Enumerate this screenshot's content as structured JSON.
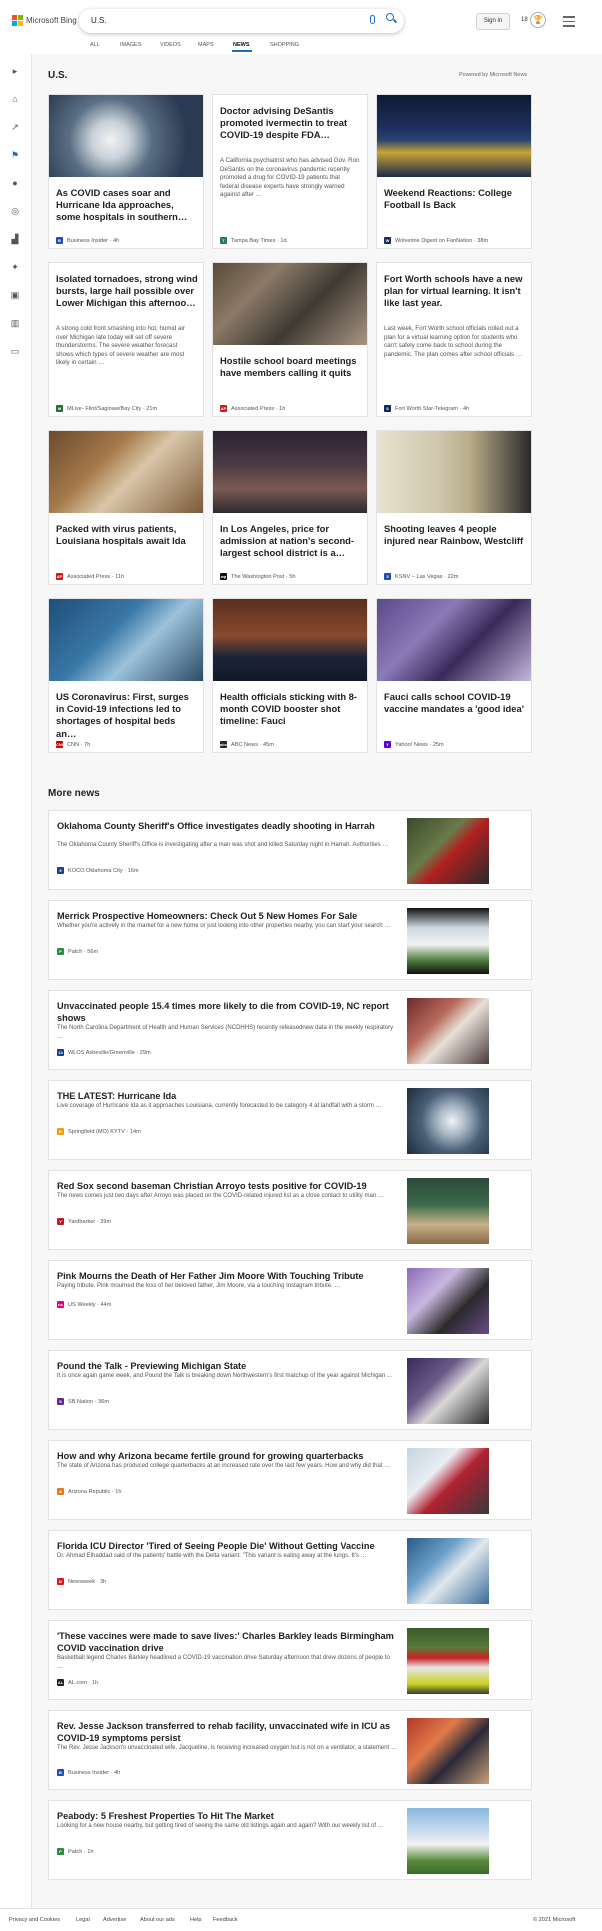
{
  "header": {
    "brand": "Microsoft Bing",
    "query": "U.S.",
    "signin": "Sign in",
    "points": "18"
  },
  "tabs": [
    "ALL",
    "IMAGES",
    "VIDEOS",
    "MAPS",
    "NEWS",
    "SHOPPING"
  ],
  "section": {
    "title": "U.S.",
    "powered": "Powered by Microsoft News"
  },
  "cards": [
    {
      "title": "As COVID cases soar and Hurricane Ida approaches, some hospitals in southern…",
      "desc": "",
      "source": "Business Insider · 4h",
      "logo": "#1f4fb5",
      "logo_text": "B"
    },
    {
      "title": "Doctor advising DeSantis promoted ivermectin to treat COVID-19 despite FDA…",
      "desc": "A California psychiatrist who has advised Gov. Ron DeSantis on the coronavirus pandemic recently promoted a drug for COVID-19 patients that federal disease experts have strongly warned against after …",
      "source": "Tampa Bay Times · 1d",
      "logo": "#2d7a4c",
      "logo_text": "T"
    },
    {
      "title": "Weekend Reactions: College Football Is Back",
      "desc": "",
      "source": "Wolverine Digest on FanNation · 38m",
      "logo": "#1a2a5a",
      "logo_text": "W"
    },
    {
      "title": "Isolated tornadoes, strong wind bursts, large hail possible over Lower Michigan this afternoo…",
      "desc": "A strong cold front smashing into hot, humid air over Michigan late today will set off severe thunderstorms. The severe weather forecast shows which types of severe weather are most likely in certain …",
      "source": "MLive- Flint/Saginaw/Bay City · 21m",
      "logo": "#2a6b3a",
      "logo_text": "M"
    },
    {
      "title": "Hostile school board meetings have members calling it quits",
      "desc": "",
      "source": "Associated Press · 1h",
      "logo": "#d2171b",
      "logo_text": "AP"
    },
    {
      "title": "Fort Worth schools have a new plan for virtual learning. It isn't like last year.",
      "desc": "Last week, Fort Worth school officials rolled out a plan for a virtual learning option for students who can't safely come back to school during the pandemic. The plan comes after school officials …",
      "source": "Fort Worth Star-Telegram · 4h",
      "logo": "#0a2a5c",
      "logo_text": "S"
    },
    {
      "title": "Packed with virus patients, Louisiana hospitals await Ida",
      "desc": "",
      "source": "Associated Press · 11h",
      "logo": "#d2171b",
      "logo_text": "AP"
    },
    {
      "title": "In Los Angeles, price for admission at nation's second-largest school district is a…",
      "desc": "",
      "source": "The Washington Post · 5h",
      "logo": "#111111",
      "logo_text": "wp"
    },
    {
      "title": "Shooting leaves 4 people injured near Rainbow, Westcliff",
      "desc": "",
      "source": "KSNV – Las Vegas · 22m",
      "logo": "#1d4fa8",
      "logo_text": "3"
    },
    {
      "title": "US Coronavirus: First, surges in Covid-19 infections led to shortages of hospital beds an…",
      "desc": "",
      "source": "CNN · 7h",
      "logo": "#cc0000",
      "logo_text": "CNN"
    },
    {
      "title": "Health officials sticking with 8-month COVID booster shot timeline: Fauci",
      "desc": "",
      "source": "ABC News · 45m",
      "logo": "#222222",
      "logo_text": "abc"
    },
    {
      "title": "Fauci calls school COVID-19 vaccine mandates a 'good idea'",
      "desc": "",
      "source": "Yahoo! News · 25m",
      "logo": "#6001d2",
      "logo_text": "Y"
    }
  ],
  "more_title": "More news",
  "more": [
    {
      "title": "Oklahoma County Sheriff's Office investigates deadly shooting in Harrah",
      "desc": "The Oklahoma County Sheriff's Office is investigating after a man was shot and killed Saturday night in Harrah. Authorities …",
      "source": "KOCO Oklahoma City · 16m",
      "logo": "#1d3e8a",
      "logo_text": "5"
    },
    {
      "title": "Merrick Prospective Homeowners: Check Out 5 New Homes For Sale",
      "desc": "Whether you're actively in the market for a new home or just looking into other properties nearby, you can start your search …",
      "source": "Patch · 56m",
      "logo": "#2b8a3e",
      "logo_text": "P"
    },
    {
      "title": "Unvaccinated people 15.4 times more likely to die from COVID-19, NC report shows",
      "desc": "The North Carolina Department of Health and Human Services (NCDHHS) recently releasednew data in the weekly respiratory …",
      "source": "WLOS Asheville/Greenville · 29m",
      "logo": "#1a3c8c",
      "logo_text": "13"
    },
    {
      "title": "THE LATEST: Hurricane Ida",
      "desc": "Live coverage of Hurricane Ida as it approaches Louisiana, currently forecasted to be category 4 at landfall with a storm …",
      "source": "Springfield (MO) KYTV · 14m",
      "logo": "#e3a21a",
      "logo_text": "K"
    },
    {
      "title": "Red Sox second baseman Christian Arroyo tests positive for COVID-19",
      "desc": "The news comes just two days after Arroyo was placed on the COVID-related injured list as a close contact to utility man …",
      "source": "Yardbarker · 39m",
      "logo": "#b81d24",
      "logo_text": "Y"
    },
    {
      "title": "Pink Mourns the Death of Her Father Jim Moore With Touching Tribute",
      "desc": "Paying tribute. Pink mourned the loss of her beloved father, Jim Moore, via a touching Instagram tribute. …",
      "source": "US Weekly · 44m",
      "logo": "#e6007e",
      "logo_text": "us"
    },
    {
      "title": "Pound the Talk - Previewing Michigan State",
      "desc": "It is once again game week, and Pound the Talk is breaking down Northwestern's first matchup of the year against Michigan …",
      "source": "SB Nation · 36m",
      "logo": "#5b2b91",
      "logo_text": "S"
    },
    {
      "title": "How and why Arizona became fertile ground for growing quarterbacks",
      "desc": "The state of Arizona has produced college quarterbacks at an increased rate over the last few years. How and why did that …",
      "source": "Arizona Republic · 1h",
      "logo": "#e67a1e",
      "logo_text": "A"
    },
    {
      "title": "Florida ICU Director 'Tired of Seeing People Die' Without Getting Vaccine",
      "desc": "Dr. Ahmad Elhaddad said of the patients' battle with the Delta variant: \"This variant is eating away at the lungs. It's …",
      "source": "Newsweek · 3h",
      "logo": "#d71920",
      "logo_text": "N"
    },
    {
      "title": "'These vaccines were made to save lives:' Charles Barkley leads Birmingham COVID vaccination drive",
      "desc": "Basketball legend Charles Barkley headlined a COVID-19 vaccination drive Saturday afternoon that drew dozens of people to …",
      "source": "AL.com · 1h",
      "logo": "#222222",
      "logo_text": "AL"
    },
    {
      "title": "Rev. Jesse Jackson transferred to rehab facility, unvaccinated wife in ICU as COVID-19 symptoms persist",
      "desc": "The Rev. Jesse Jackson's unvaccinated wife, Jacqueline, is receiving increased oxygen but is not on a ventilator, a statement …",
      "source": "Business Insider · 4h",
      "logo": "#1f4fb5",
      "logo_text": "B"
    },
    {
      "title": "Peabody: 5 Freshest Properties To Hit The Market",
      "desc": "Looking for a new house nearby, but getting tired of seeing the same old listings again and again? With our weekly list of …",
      "source": "Patch · 1h",
      "logo": "#2b8a3e",
      "logo_text": "P"
    }
  ],
  "footer": {
    "links": [
      "Privacy and Cookies",
      "Legal",
      "Advertise",
      "About our ads",
      "Help",
      "Feedback"
    ],
    "copyright": "© 2021 Microsoft"
  }
}
